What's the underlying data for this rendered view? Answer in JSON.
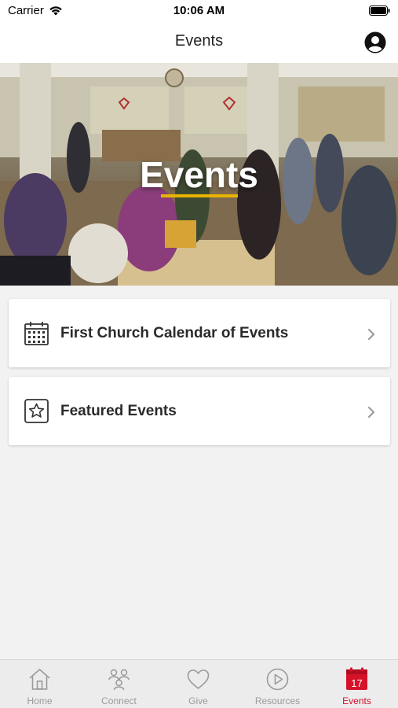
{
  "status_bar": {
    "carrier": "Carrier",
    "time": "10:06 AM",
    "icons": [
      "wifi-icon",
      "battery-icon"
    ]
  },
  "nav": {
    "title": "Events",
    "profile_icon": "user-avatar-icon"
  },
  "hero": {
    "title": "Events",
    "underline_color": "#e8b400"
  },
  "menu": {
    "items": [
      {
        "label": "First Church Calendar of Events",
        "icon": "calendar-grid-icon"
      },
      {
        "label": "Featured Events",
        "icon": "star-box-icon"
      }
    ]
  },
  "tab_bar": {
    "active_color": "#d5122a",
    "inactive_color": "#9a9a9a",
    "tabs": [
      {
        "label": "Home",
        "icon": "home-icon"
      },
      {
        "label": "Connect",
        "icon": "people-icon"
      },
      {
        "label": "Give",
        "icon": "heart-icon"
      },
      {
        "label": "Resources",
        "icon": "play-icon"
      },
      {
        "label": "Events",
        "icon": "calendar-icon",
        "calendar_day": "17"
      }
    ]
  }
}
